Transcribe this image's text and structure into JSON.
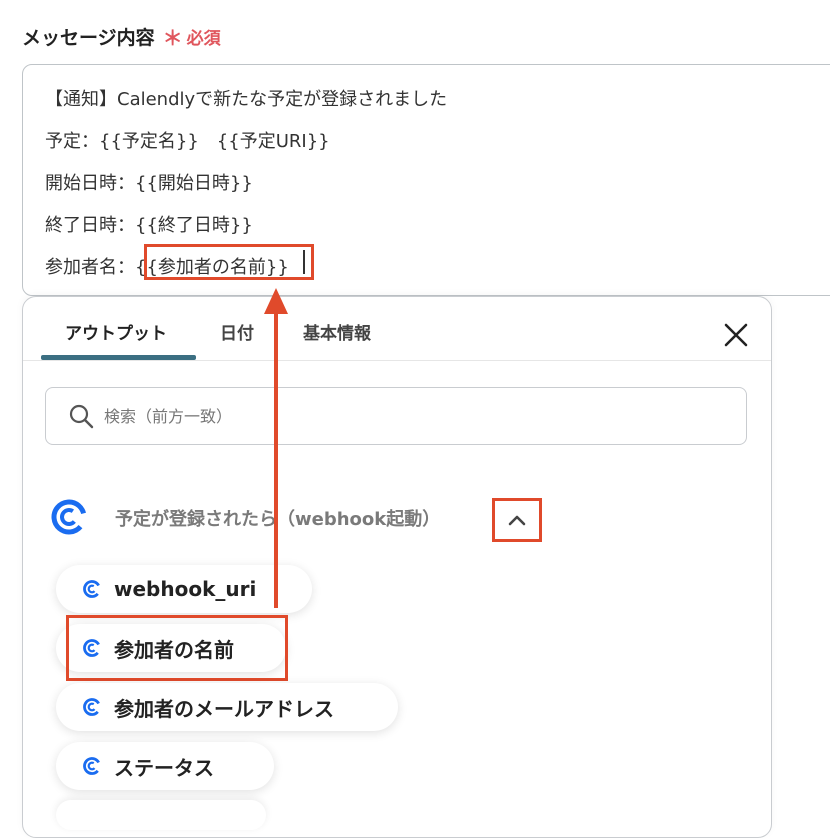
{
  "field": {
    "label": "メッセージ内容",
    "required_star": "＊",
    "required_text": "必須"
  },
  "message": {
    "lines": [
      "【通知】Calendlyで新たな予定が登録されました",
      "予定：{{予定名}}　{{予定URI}}",
      "開始日時：{{開始日時}}",
      "終了日時：{{終了日時}}",
      "参加者名：{{参加者の名前}}"
    ]
  },
  "panel": {
    "tabs": [
      {
        "label": "アウトプット",
        "active": true
      },
      {
        "label": "日付",
        "active": false
      },
      {
        "label": "基本情報",
        "active": false
      }
    ],
    "search_placeholder": "検索（前方一致）",
    "group_label": "予定が登録されたら（webhook起動）",
    "items": [
      {
        "label": "webhook_uri"
      },
      {
        "label": "参加者の名前"
      },
      {
        "label": "参加者のメールアドレス"
      },
      {
        "label": "ステータス"
      }
    ]
  },
  "colors": {
    "accent": "#3b6f82",
    "highlight": "#e04a2b",
    "calendly_blue": "#1a6cf0",
    "required": "#e0565d"
  }
}
